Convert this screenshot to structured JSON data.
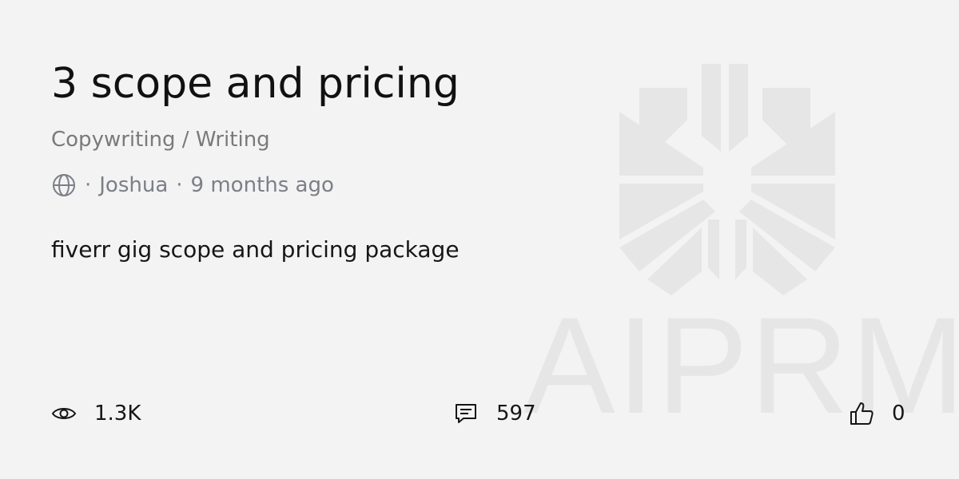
{
  "prompt": {
    "title": "3 scope and pricing",
    "category": "Copywriting / Writing",
    "visibility_icon": "globe-icon",
    "separator": "·",
    "author": "Joshua",
    "time_ago": "9 months ago",
    "description": "fiverr gig scope and pricing package"
  },
  "stats": {
    "views": {
      "icon": "eye-icon",
      "value": "1.3K"
    },
    "comments": {
      "icon": "comment-icon",
      "value": "597"
    },
    "likes": {
      "icon": "thumbs-up-icon",
      "value": "0"
    }
  },
  "watermark": {
    "text": "AIPRM",
    "color": "#e6e6e6"
  },
  "colors": {
    "background": "#f3f3f3",
    "title": "#111111",
    "muted": "#7a7a7a"
  }
}
